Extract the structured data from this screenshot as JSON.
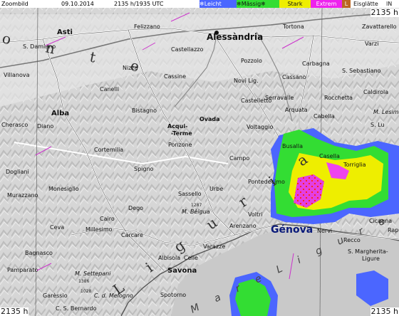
{
  "header": {
    "title": "Zoombild",
    "date": "09.10.2014",
    "time": "2135 h/1935 UTC"
  },
  "legend": [
    {
      "label": "Leicht",
      "color": "#4b66ff",
      "icon": "snowflake-icon"
    },
    {
      "label": "Mässig",
      "color": "#33dd33",
      "icon": "snowflake-icon"
    },
    {
      "label": "Stark",
      "color": "#eeee00",
      "icon": ""
    },
    {
      "label": "Extrem",
      "color": "#ee22ee",
      "icon": ""
    },
    {
      "label": "L",
      "color": "#bb6622",
      "icon": ""
    },
    {
      "label": "Eisglätte",
      "color": "#ffffff",
      "icon": ""
    },
    {
      "label": "lN",
      "color": "#ffffff",
      "icon": ""
    }
  ],
  "corners": {
    "top_right": "2135 h",
    "bottom_left": "2135 h",
    "bottom_right": "2135 h",
    "left_cut": "2135 h"
  },
  "places": {
    "alessandria": "Alessàndria",
    "genova": "Génova",
    "savona": "Savona",
    "asti": "Asti",
    "alba": "Alba",
    "tortona": "Tortona",
    "novi": "Novi Lig.",
    "ovada": "Ovada",
    "acqui": "Acqui-",
    "terme": "-Terme",
    "nizza": "Nizza",
    "canelli": "Canelli",
    "bistagno": "Bistagno",
    "cassine": "Cassine",
    "felizzano": "Felizzano",
    "castellazzo": "Castellazzo",
    "sdamiano": "S. Damiano",
    "villanova": "Villanova",
    "serravalle": "Serravalle",
    "arquata": "Arquata",
    "castelletto": "Castelletto",
    "voltaggio": "Voltaggio",
    "busalla": "Busalla",
    "casella": "Casella",
    "torriglia": "Torriglia",
    "campo": "Campo",
    "pontedecimo": "Pontedecimo",
    "voltri": "Voltri",
    "arenzano": "Arenzano",
    "varazze": "Varazze",
    "celle": "Celle",
    "albisola": "Albisola",
    "nervi": "Nervi",
    "recco": "Recco",
    "cicagna": "Cicagna",
    "smargherita": "S. Margherita-",
    "ligure": "Ligure",
    "rapallo": "Rap",
    "spotorno": "Spotorno",
    "sassello": "Sassello",
    "urbe": "Urbe",
    "mbeigua": "M. Bèigua",
    "ponzone": "Ponzone",
    "spigno": "Spigno",
    "cortemilia": "Cortemilia",
    "dego": "Dego",
    "cairo": "Cairo",
    "carcare": "Carcare",
    "millesimo": "Millesimo",
    "monesiglio": "Monesiglio",
    "murazzano": "Murazzano",
    "dogliani": "Dogliani",
    "diano": "Diano",
    "cherasco": "Cherasco",
    "ceva": "Ceva",
    "bagnasco": "Bagnasco",
    "pamparato": "Pamparato",
    "garessio": "Garèssio",
    "csbernardo": "C. S. Bernardo",
    "msettepani": "M. Settepani",
    "cdimelogno": "C. d. Melogno",
    "carbagna": "Carbagna",
    "ssebastiano": "S. Sebastiano",
    "rocchetta": "Rocchetta",
    "cabella": "Cabella",
    "caldirola": "Caldirola",
    "zavattarello": "Zavattarello",
    "varzi": "Varzi",
    "pozzolo": "Pozzolo",
    "cassano": "Cassano",
    "mlesima": "M. Lesima",
    "sulli": "S. Lu"
  },
  "region_letters": {
    "piemonte": "o n t e",
    "liguria": "L i g u r i a",
    "sea": "M a r e   L i g u r e"
  },
  "elevations": {
    "beigua": "1287",
    "settepani": "1386",
    "melogno": "1028"
  }
}
